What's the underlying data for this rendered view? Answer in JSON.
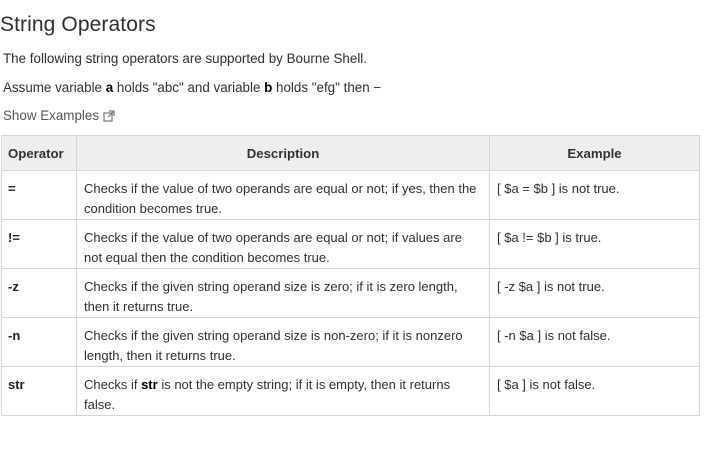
{
  "heading": "String Operators",
  "intro": {
    "line1": "The following string operators are supported by Bourne Shell.",
    "line2_prefix": "Assume variable ",
    "line2_var_a": "a",
    "line2_mid1": " holds \"abc\" and variable ",
    "line2_var_b": "b",
    "line2_suffix": " holds \"efg\" then −"
  },
  "show_examples_label": "Show Examples",
  "show_examples_icon": "external-link-icon",
  "table": {
    "headers": [
      "Operator",
      "Description",
      "Example"
    ],
    "rows": [
      {
        "operator": "=",
        "description": "Checks if the value of two operands are equal or not; if yes, then the condition becomes true.",
        "example": "[ $a = $b ] is not true."
      },
      {
        "operator": "!=",
        "description": "Checks if the value of two operands are equal or not; if values are not equal then the condition becomes true.",
        "example": "[ $a != $b ] is true."
      },
      {
        "operator": "-z",
        "description": "Checks if the given string operand size is zero; if it is zero length, then it returns true.",
        "example": "[ -z $a ] is not true."
      },
      {
        "operator": "-n",
        "description": "Checks if the given string operand size is non-zero; if it is nonzero length, then it returns true.",
        "example": "[ -n $a ] is not false."
      },
      {
        "operator": "str",
        "description_prefix": "Checks if ",
        "description_bold": "str",
        "description_suffix": " is not the empty string; if it is empty, then it returns false.",
        "example": "[ $a ] is not false."
      }
    ]
  },
  "colors": {
    "text": "#313131",
    "header_bg": "#eeeeee",
    "border": "#d6d6d6"
  }
}
